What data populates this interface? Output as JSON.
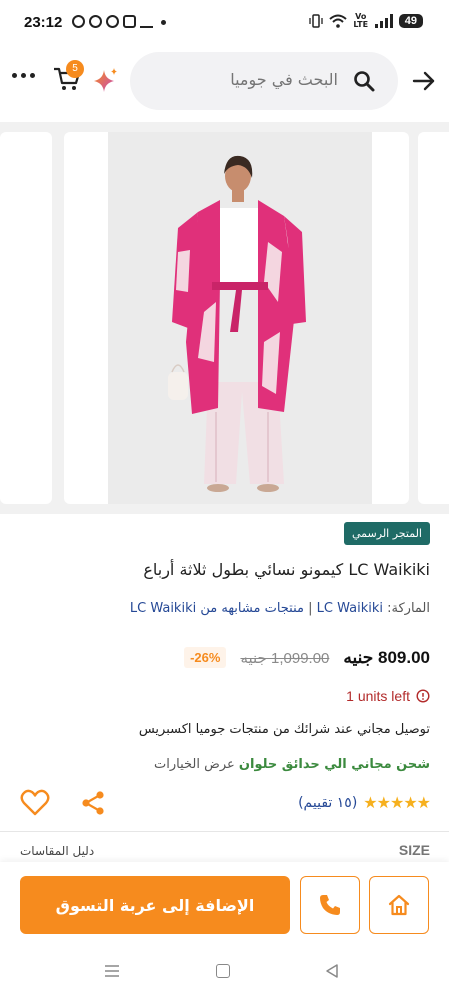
{
  "status_bar": {
    "time": "23:12",
    "volte": "Vo LTE",
    "battery": "49"
  },
  "header": {
    "cart_count": "5",
    "search_placeholder": "البحث في جوميا"
  },
  "product": {
    "official_badge": "المتجر الرسمي",
    "title": "LC Waikiki كيمونو نسائي بطول ثلاثة أرباع",
    "brand_prefix": "الماركة:",
    "brand_name": "LC Waikiki",
    "brand_separator": " | ",
    "similar_label": "منتجات مشابهه من LC Waikiki",
    "price": "809.00 جنيه",
    "old_price": "1,099.00 جنيه",
    "discount": "-26%",
    "stock": "1 units left",
    "express_text": "توصيل مجاني عند شرائك من منتجات جوميا اكسبريس",
    "shipping_free": "شحن مجاني الي حدائق حلوان",
    "shipping_options": "عرض الخيارات",
    "stars": "★★★★★",
    "rating_count": "(١٥ تقييم)"
  },
  "size": {
    "label": "SIZE",
    "guide": "دليل المقاسات"
  },
  "actions": {
    "add_to_cart": "الإضافة إلى عربة التسوق"
  },
  "colors": {
    "accent": "#f68b1e",
    "official_badge": "#1f6b66",
    "link": "#264996",
    "stock_warning": "#b22a2a",
    "shipping_green": "#3b8a3e",
    "kimono_pink": "#e0307a"
  },
  "icons": [
    "more-icon",
    "cart-icon",
    "sparkle-icon",
    "search-icon",
    "back-arrow-icon",
    "alert-icon",
    "share-icon",
    "heart-icon",
    "phone-icon",
    "home-icon"
  ]
}
